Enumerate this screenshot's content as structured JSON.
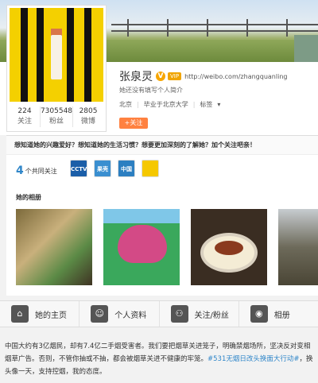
{
  "profile": {
    "name": "张泉灵",
    "verified_badge": "V",
    "vip_badge": "VIP",
    "url": "http://weibo.com/zhangquanling",
    "intro": "她还没有填写个人简介",
    "location": "北京",
    "school": "毕业于北京大学",
    "tags": "标签",
    "follow_button": "+关注"
  },
  "stats": [
    {
      "num": "224",
      "label": "关注"
    },
    {
      "num": "7305548",
      "label": "粉丝"
    },
    {
      "num": "2805",
      "label": "微博"
    }
  ],
  "banner": "想知道她的兴趣爱好？想知道她的生活习惯？想要更加深刻的了解她？加个关注吧亲！",
  "common": {
    "count": "4",
    "label": "个共同关注"
  },
  "mini_icons": [
    {
      "name": "cctv-icon",
      "text": "CCTV",
      "color": "#1b5ea8"
    },
    {
      "name": "guokr-icon",
      "text": "果壳",
      "color": "#3a8fd0"
    },
    {
      "name": "news-icon",
      "text": "中国",
      "color": "#2c7fc1"
    },
    {
      "name": "bird-icon",
      "text": "",
      "color": "#f5c800"
    }
  ],
  "album_title": "她的相册",
  "tabs": [
    {
      "label": "她的主页",
      "icon": "home-icon"
    },
    {
      "label": "个人资料",
      "icon": "person-icon"
    },
    {
      "label": "关注/粉丝",
      "icon": "users-icon"
    },
    {
      "label": "相册",
      "icon": "camera-icon"
    }
  ],
  "post": {
    "text": "中国大约有3亿烟民，却有7.4亿二手烟受害者。我们要把烟草关进笼子，明确禁烟场所，坚决反对变相烟草广告。否则，不管你抽或不抽，都会被烟草关进不健康的牢笼。",
    "hashtag": "#531无烟日改头换面大行动#",
    "text_end": "，换头像一天，支持控烟，我的态度。"
  }
}
